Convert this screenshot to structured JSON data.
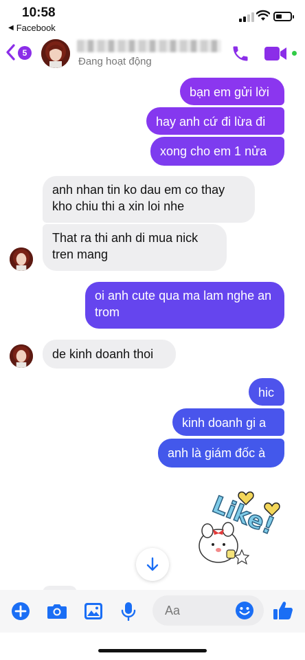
{
  "status_bar": {
    "time": "10:58",
    "back_app": "Facebook"
  },
  "header": {
    "unread_count": "5",
    "contact_status": "Đang hoạt động"
  },
  "messages": [
    {
      "side": "out",
      "text": "bạn em gửi lời"
    },
    {
      "side": "out",
      "text": "hay anh cứ đi lừa đi"
    },
    {
      "side": "out",
      "text": "xong cho em 1 nửa"
    },
    {
      "side": "in",
      "text": "anh nhan tin ko dau em co thay kho chiu thi a xin loi nhe"
    },
    {
      "side": "in",
      "text": "That ra thi anh di mua nick tren mang"
    },
    {
      "side": "out",
      "text": "oi anh cute qua ma lam nghe an trom"
    },
    {
      "side": "in",
      "text": "de kinh doanh thoi"
    },
    {
      "side": "out",
      "text": "hic"
    },
    {
      "side": "out",
      "text": "kinh doanh gi a"
    },
    {
      "side": "out",
      "text": "anh là giám đốc à"
    }
  ],
  "sticker": {
    "text": "Like!",
    "icon": "like-sticker"
  },
  "composer": {
    "placeholder": "Aa"
  },
  "icons": {
    "back": "chevron-left-icon",
    "call": "phone-icon",
    "video": "video-camera-icon",
    "add": "plus-icon",
    "camera": "camera-icon",
    "gallery": "image-icon",
    "mic": "microphone-icon",
    "emoji": "smiley-icon",
    "like": "thumbs-up-icon",
    "scroll": "arrow-down-icon"
  },
  "colors": {
    "accent": "#8b2ee8",
    "outgoing_top": "#8b36ef",
    "outgoing_bottom": "#4358eb",
    "incoming": "#eeeef0",
    "composer_icon": "#1a6ef5",
    "online": "#31cc46"
  }
}
